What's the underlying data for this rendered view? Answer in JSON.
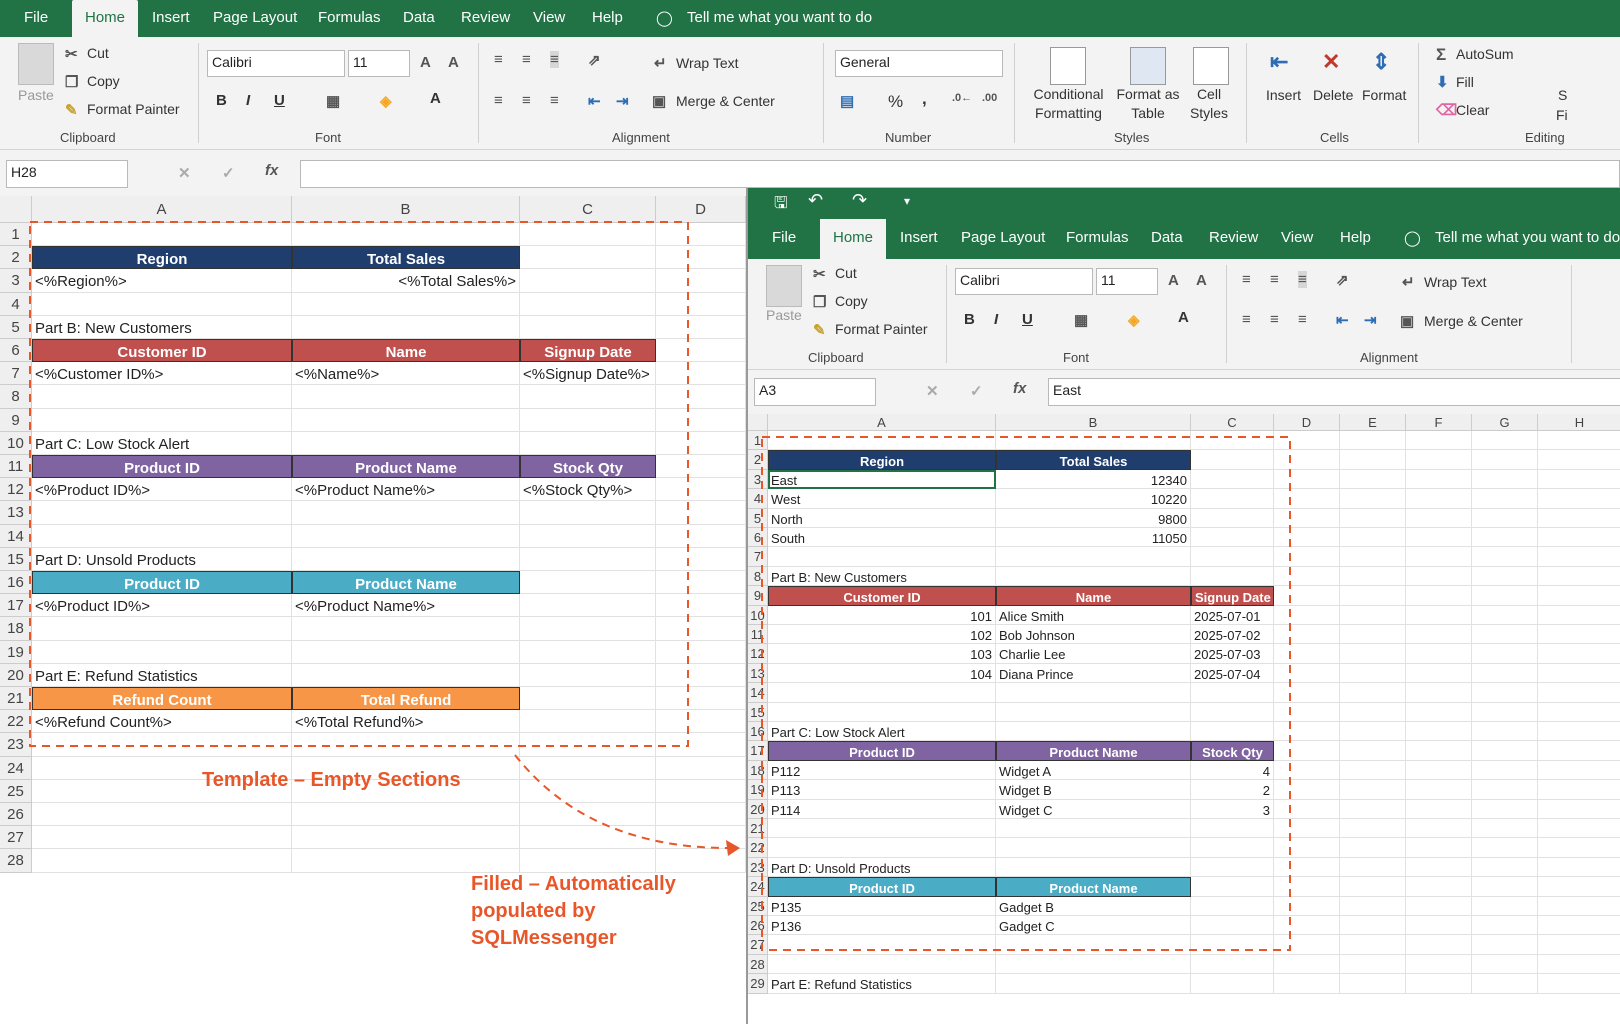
{
  "menu": {
    "tabs": [
      "File",
      "Home",
      "Insert",
      "Page Layout",
      "Formulas",
      "Data",
      "Review",
      "View",
      "Help"
    ],
    "tell": "Tell me what you want to do"
  },
  "ribbon": {
    "paste": "Paste",
    "cut": "Cut",
    "copy": "Copy",
    "format_painter": "Format Painter",
    "clipboard": "Clipboard",
    "font_name": "Calibri",
    "font_size": "11",
    "bold": "B",
    "italic": "I",
    "underline": "U",
    "font_group": "Font",
    "wrap_text": "Wrap Text",
    "merge_center": "Merge & Center",
    "alignment": "Alignment",
    "number_format": "General",
    "percent": "%",
    "comma": ",",
    "number_group": "Number",
    "cond_format": "Conditional Formatting",
    "format_table": "Format as Table",
    "cell_styles": "Cell Styles",
    "styles": "Styles",
    "insert": "Insert",
    "delete": "Delete",
    "format": "Format",
    "cells": "Cells",
    "autosum": "AutoSum",
    "fill": "Fill",
    "clear": "Clear",
    "editing": "Editing",
    "sort_cut": "S",
    "find_cut": "Fi"
  },
  "left": {
    "name_box": "H28",
    "formula": "",
    "col_headers": [
      "A",
      "B",
      "C",
      "D"
    ],
    "row_headers": [
      "1",
      "2",
      "3",
      "4",
      "5",
      "6",
      "7",
      "8",
      "9",
      "10",
      "11",
      "12",
      "13",
      "14",
      "15",
      "16",
      "17",
      "18",
      "19",
      "20",
      "21",
      "22",
      "23",
      "24",
      "25",
      "26",
      "27",
      "28"
    ],
    "cells": [
      {
        "r": 2,
        "c": 0,
        "t": "Region",
        "hd": "navy"
      },
      {
        "r": 2,
        "c": 1,
        "t": "Total Sales",
        "hd": "navy"
      },
      {
        "r": 3,
        "c": 0,
        "t": "<%Region%>"
      },
      {
        "r": 3,
        "c": 1,
        "t": "<%Total Sales%>",
        "right": true
      },
      {
        "r": 5,
        "c": 0,
        "t": "Part B: New Customers"
      },
      {
        "r": 6,
        "c": 0,
        "t": "Customer ID",
        "hd": "red"
      },
      {
        "r": 6,
        "c": 1,
        "t": "Name",
        "hd": "red"
      },
      {
        "r": 6,
        "c": 2,
        "t": "Signup Date",
        "hd": "red"
      },
      {
        "r": 7,
        "c": 0,
        "t": "<%Customer ID%>"
      },
      {
        "r": 7,
        "c": 1,
        "t": "<%Name%>"
      },
      {
        "r": 7,
        "c": 2,
        "t": "<%Signup Date%>"
      },
      {
        "r": 10,
        "c": 0,
        "t": "Part C: Low Stock Alert"
      },
      {
        "r": 11,
        "c": 0,
        "t": "Product ID",
        "hd": "purple"
      },
      {
        "r": 11,
        "c": 1,
        "t": "Product Name",
        "hd": "purple"
      },
      {
        "r": 11,
        "c": 2,
        "t": "Stock Qty",
        "hd": "purple"
      },
      {
        "r": 12,
        "c": 0,
        "t": "<%Product ID%>"
      },
      {
        "r": 12,
        "c": 1,
        "t": "<%Product Name%>"
      },
      {
        "r": 12,
        "c": 2,
        "t": "<%Stock Qty%>"
      },
      {
        "r": 15,
        "c": 0,
        "t": "Part D: Unsold Products"
      },
      {
        "r": 16,
        "c": 0,
        "t": "Product ID",
        "hd": "teal"
      },
      {
        "r": 16,
        "c": 1,
        "t": "Product Name",
        "hd": "teal"
      },
      {
        "r": 17,
        "c": 0,
        "t": "<%Product ID%>"
      },
      {
        "r": 17,
        "c": 1,
        "t": "<%Product Name%>"
      },
      {
        "r": 20,
        "c": 0,
        "t": "Part E: Refund Statistics"
      },
      {
        "r": 21,
        "c": 0,
        "t": "Refund Count",
        "hd": "orange"
      },
      {
        "r": 21,
        "c": 1,
        "t": "Total Refund",
        "hd": "orange"
      },
      {
        "r": 22,
        "c": 0,
        "t": "<%Refund Count%>"
      },
      {
        "r": 22,
        "c": 1,
        "t": "<%Total Refund%>"
      }
    ]
  },
  "right": {
    "name_box": "A3",
    "formula": "East",
    "col_headers": [
      "A",
      "B",
      "C",
      "D",
      "E",
      "F",
      "G",
      "H"
    ],
    "row_headers": [
      "1",
      "2",
      "3",
      "4",
      "5",
      "6",
      "7",
      "8",
      "9",
      "10",
      "11",
      "12",
      "13",
      "14",
      "15",
      "16",
      "17",
      "18",
      "19",
      "20",
      "21",
      "22",
      "23",
      "24",
      "25",
      "26",
      "27",
      "28",
      "29"
    ],
    "cells": [
      {
        "r": 2,
        "c": 0,
        "t": "Region",
        "hd": "navy"
      },
      {
        "r": 2,
        "c": 1,
        "t": "Total Sales",
        "hd": "navy"
      },
      {
        "r": 3,
        "c": 0,
        "t": "East",
        "sel": true
      },
      {
        "r": 3,
        "c": 1,
        "t": "12340",
        "right": true
      },
      {
        "r": 4,
        "c": 0,
        "t": "West"
      },
      {
        "r": 4,
        "c": 1,
        "t": "10220",
        "right": true
      },
      {
        "r": 5,
        "c": 0,
        "t": "North"
      },
      {
        "r": 5,
        "c": 1,
        "t": "9800",
        "right": true
      },
      {
        "r": 6,
        "c": 0,
        "t": "South"
      },
      {
        "r": 6,
        "c": 1,
        "t": "11050",
        "right": true
      },
      {
        "r": 8,
        "c": 0,
        "t": "Part B: New Customers"
      },
      {
        "r": 9,
        "c": 0,
        "t": "Customer ID",
        "hd": "red"
      },
      {
        "r": 9,
        "c": 1,
        "t": "Name",
        "hd": "red"
      },
      {
        "r": 9,
        "c": 2,
        "t": "Signup Date",
        "hd": "red"
      },
      {
        "r": 10,
        "c": 0,
        "t": "101",
        "right": true
      },
      {
        "r": 10,
        "c": 1,
        "t": "Alice Smith"
      },
      {
        "r": 10,
        "c": 2,
        "t": "2025-07-01"
      },
      {
        "r": 11,
        "c": 0,
        "t": "102",
        "right": true
      },
      {
        "r": 11,
        "c": 1,
        "t": "Bob Johnson"
      },
      {
        "r": 11,
        "c": 2,
        "t": "2025-07-02"
      },
      {
        "r": 12,
        "c": 0,
        "t": "103",
        "right": true
      },
      {
        "r": 12,
        "c": 1,
        "t": "Charlie Lee"
      },
      {
        "r": 12,
        "c": 2,
        "t": "2025-07-03"
      },
      {
        "r": 13,
        "c": 0,
        "t": "104",
        "right": true
      },
      {
        "r": 13,
        "c": 1,
        "t": "Diana Prince"
      },
      {
        "r": 13,
        "c": 2,
        "t": "2025-07-04"
      },
      {
        "r": 16,
        "c": 0,
        "t": "Part C: Low Stock Alert"
      },
      {
        "r": 17,
        "c": 0,
        "t": "Product ID",
        "hd": "purple"
      },
      {
        "r": 17,
        "c": 1,
        "t": "Product Name",
        "hd": "purple"
      },
      {
        "r": 17,
        "c": 2,
        "t": "Stock Qty",
        "hd": "purple"
      },
      {
        "r": 18,
        "c": 0,
        "t": "P112"
      },
      {
        "r": 18,
        "c": 1,
        "t": "Widget A"
      },
      {
        "r": 18,
        "c": 2,
        "t": "4",
        "right": true
      },
      {
        "r": 19,
        "c": 0,
        "t": "P113"
      },
      {
        "r": 19,
        "c": 1,
        "t": "Widget B"
      },
      {
        "r": 19,
        "c": 2,
        "t": "2",
        "right": true
      },
      {
        "r": 20,
        "c": 0,
        "t": "P114"
      },
      {
        "r": 20,
        "c": 1,
        "t": "Widget C"
      },
      {
        "r": 20,
        "c": 2,
        "t": "3",
        "right": true
      },
      {
        "r": 23,
        "c": 0,
        "t": "Part D: Unsold Products"
      },
      {
        "r": 24,
        "c": 0,
        "t": "Product ID",
        "hd": "teal"
      },
      {
        "r": 24,
        "c": 1,
        "t": "Product Name",
        "hd": "teal"
      },
      {
        "r": 25,
        "c": 0,
        "t": "P135"
      },
      {
        "r": 25,
        "c": 1,
        "t": "Gadget B"
      },
      {
        "r": 26,
        "c": 0,
        "t": "P136"
      },
      {
        "r": 26,
        "c": 1,
        "t": "Gadget C"
      },
      {
        "r": 29,
        "c": 0,
        "t": "Part E: Refund Statistics"
      }
    ]
  },
  "annotations": {
    "template": "Template – Empty Sections",
    "filled_1": "Filled – Automatically",
    "filled_2": "populated by",
    "filled_3": "SQLMessenger"
  },
  "colors": {
    "navy": "#1f3e6e",
    "red": "#c0504d",
    "purple": "#8064a2",
    "teal": "#4bacc6",
    "orange": "#f79646",
    "excel_green": "#217346",
    "annotation": "#e8572a"
  }
}
